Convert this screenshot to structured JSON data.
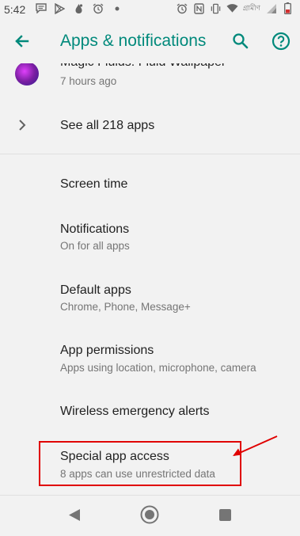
{
  "status_bar": {
    "time": "5:42",
    "carrier": "গ্রামীণ",
    "left_icons": [
      "message-icon",
      "play-store-icon",
      "leaf-icon",
      "alarm-icon",
      "dot-icon"
    ],
    "right_icons": [
      "alarm-icon",
      "nfc-icon",
      "vibrate-icon",
      "wifi-icon",
      "signal-icon",
      "battery-icon"
    ]
  },
  "app_bar": {
    "title": "Apps & notifications",
    "accent_color": "#00897b"
  },
  "list": {
    "recent_app": {
      "name": "Magic Fluids: Fluid Wallpaper",
      "time": "7 hours ago"
    },
    "see_all": "See all 218 apps",
    "items": [
      {
        "title": "Screen time",
        "subtitle": ""
      },
      {
        "title": "Notifications",
        "subtitle": "On for all apps"
      },
      {
        "title": "Default apps",
        "subtitle": "Chrome, Phone, Message+"
      },
      {
        "title": "App permissions",
        "subtitle": "Apps using location, microphone, camera"
      },
      {
        "title": "Wireless emergency alerts",
        "subtitle": ""
      },
      {
        "title": "Special app access",
        "subtitle": "8 apps can use unrestricted data"
      }
    ]
  },
  "annotation": {
    "highlight_color": "#e00000"
  }
}
